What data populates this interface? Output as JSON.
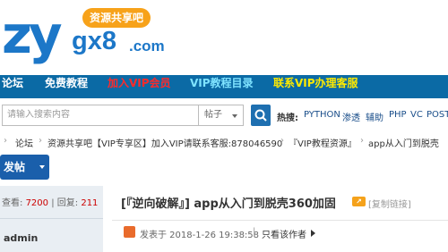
{
  "logo": {
    "part1": "zy",
    "part2": "gx8",
    "part3": ".com",
    "badge": "资源共享吧"
  },
  "nav": {
    "items": [
      {
        "label": "论坛",
        "color": "#ffffff"
      },
      {
        "label": "免费教程",
        "color": "#ffffff"
      },
      {
        "label": "加入VIP会员",
        "color": "#ff2a2a"
      },
      {
        "label": "VIP教程目录",
        "color": "#7fe3ff"
      },
      {
        "label": "联系VIP办理客服",
        "color": "#ffea00"
      }
    ],
    "bg_color": "#0b6aa5"
  },
  "search": {
    "placeholder": "请输入搜索内容",
    "type": "帖子",
    "hot_label": "热搜:",
    "hot_items": [
      "PYTHON",
      "渗透",
      "辅助",
      "PHP",
      "VC",
      "POST"
    ]
  },
  "breadcrumb": {
    "items": [
      "论坛",
      "资源共享吧【VIP专享区】加入VIP请联系客服:878046590",
      "『VIP教程资源』",
      "app从入门到脱壳"
    ]
  },
  "post_button": {
    "label": "发帖"
  },
  "thread": {
    "views_label": "查看:",
    "views": "7200",
    "replies_label": "回复:",
    "replies": "211",
    "title": "[『逆向破解』] app从入门到脱壳360加固",
    "copy_link": "[复制链接]",
    "author": "admin",
    "posted_at": "发表于 2018-1-26 19:38:58",
    "only_author": "只看该作者"
  }
}
